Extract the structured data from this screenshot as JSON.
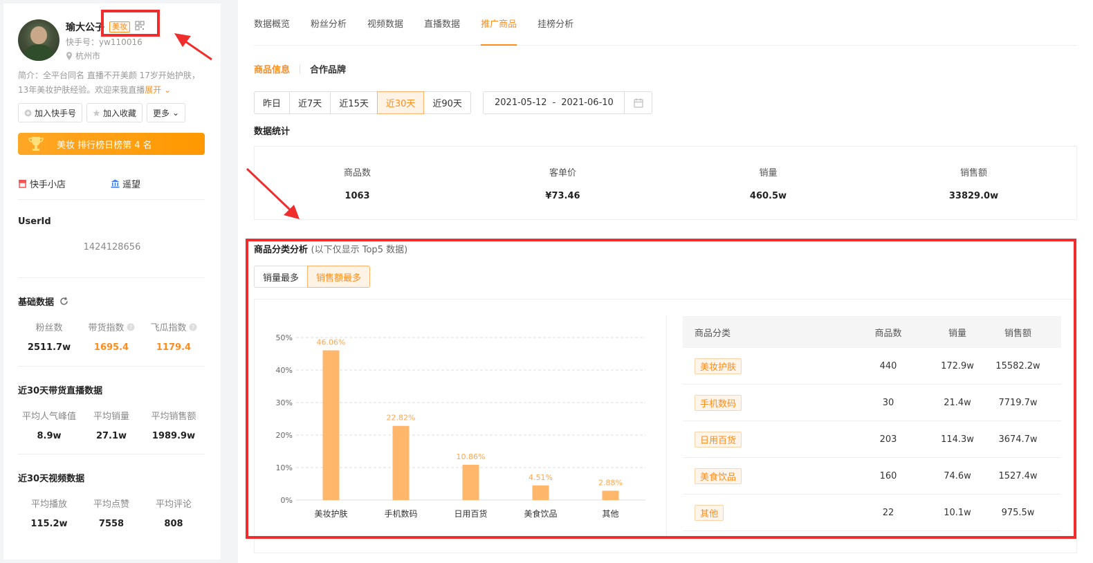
{
  "profile": {
    "name": "瑜大公子",
    "category_tag": "美妆",
    "kuaishou_id": "快手号：yw110016",
    "city": "杭州市",
    "intro": "简介：全平台同名 直播不开美颜 17岁开始护肤，13年美妆护肤经验。欢迎来我直播",
    "expand_label": "展开",
    "buttons": {
      "follow": "加入快手号",
      "favorite": "加入收藏",
      "more": "更多"
    },
    "rank_text": "美妆 排行榜日榜第 4 名",
    "links": {
      "shop": "快手小店",
      "lookout": "遥望"
    },
    "userid_title": "UserId",
    "userid_value": "1424128656",
    "basic": {
      "title": "基础数据",
      "items": [
        {
          "label": "粉丝数",
          "value": "2511.7w"
        },
        {
          "label": "带货指数",
          "value": "1695.4"
        },
        {
          "label": "飞瓜指数",
          "value": "1179.4"
        }
      ]
    },
    "live30": {
      "title": "近30天带货直播数据",
      "items": [
        {
          "label": "平均人气峰值",
          "value": "8.9w"
        },
        {
          "label": "平均销量",
          "value": "27.1w"
        },
        {
          "label": "平均销售额",
          "value": "1989.9w"
        }
      ]
    },
    "video30": {
      "title": "近30天视频数据",
      "items": [
        {
          "label": "平均播放",
          "value": "115.2w"
        },
        {
          "label": "平均点赞",
          "value": "7558"
        },
        {
          "label": "平均评论",
          "value": "808"
        }
      ]
    }
  },
  "tabs": [
    "数据概览",
    "粉丝分析",
    "视频数据",
    "直播数据",
    "推广商品",
    "挂榜分析"
  ],
  "active_tab": "推广商品",
  "subtabs": [
    "商品信息",
    "合作品牌"
  ],
  "ranges": [
    "昨日",
    "近7天",
    "近15天",
    "近30天",
    "近90天"
  ],
  "active_range": "近30天",
  "date_start": "2021-05-12",
  "date_end": "2021-06-10",
  "stats": {
    "title": "数据统计",
    "items": [
      {
        "label": "商品数",
        "value": "1063"
      },
      {
        "label": "客单价",
        "value": "¥73.46"
      },
      {
        "label": "销量",
        "value": "460.5w"
      },
      {
        "label": "销售额",
        "value": "33829.0w"
      }
    ]
  },
  "category_section": {
    "title": "商品分类分析",
    "note": "(以下仅显示 Top5 数据)",
    "sort_options": [
      "销量最多",
      "销售额最多"
    ],
    "active_sort": "销售额最多"
  },
  "table": {
    "headers": [
      "商品分类",
      "商品数",
      "销量",
      "销售额"
    ],
    "rows": [
      {
        "category": "美妆护肤",
        "count": "440",
        "sales": "172.9w",
        "revenue": "15582.2w"
      },
      {
        "category": "手机数码",
        "count": "30",
        "sales": "21.4w",
        "revenue": "7719.7w"
      },
      {
        "category": "日用百货",
        "count": "203",
        "sales": "114.3w",
        "revenue": "3674.7w"
      },
      {
        "category": "美食饮品",
        "count": "160",
        "sales": "74.6w",
        "revenue": "1527.4w"
      },
      {
        "category": "其他",
        "count": "22",
        "sales": "10.1w",
        "revenue": "975.5w"
      }
    ]
  },
  "chart_data": {
    "type": "bar",
    "categories": [
      "美妆护肤",
      "手机数码",
      "日用百货",
      "美食饮品",
      "其他"
    ],
    "values": [
      46.06,
      22.82,
      10.86,
      4.51,
      2.88
    ],
    "value_labels": [
      "46.06%",
      "22.82%",
      "10.86%",
      "4.51%",
      "2.88%"
    ],
    "yticks": [
      "0%",
      "10%",
      "20%",
      "30%",
      "40%",
      "50%"
    ],
    "ylim": [
      0,
      50
    ],
    "grid": true,
    "bar_color": "#ffb86b"
  },
  "colors": {
    "accent": "#ff8c1a",
    "annotation": "#ef2d2d"
  }
}
